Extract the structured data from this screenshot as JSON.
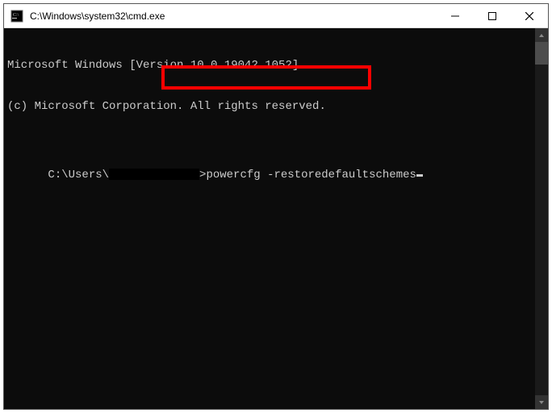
{
  "window": {
    "title": "C:\\Windows\\system32\\cmd.exe"
  },
  "terminal": {
    "line1": "Microsoft Windows [Version 10.0.19042.1052]",
    "line2": "(c) Microsoft Corporation. All rights reserved.",
    "prompt_prefix": "C:\\Users\\",
    "prompt_suffix": ">",
    "command": "powercfg -restoredefaultschemes"
  },
  "highlight": {
    "color": "#ff0000"
  }
}
